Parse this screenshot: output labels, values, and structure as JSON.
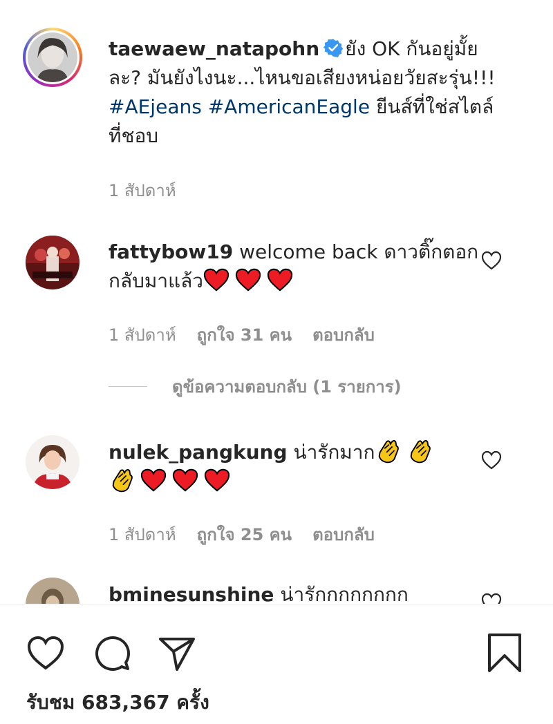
{
  "post": {
    "author": "taewaew_natapohn",
    "caption_plain": "ยัง OK กันอยู่มั้ยละ? มันยังไงนะ...ไหนขอเสียงหน่อยวัยสะรุ่น!!! ",
    "hashtag1": "#AEjeans",
    "hashtag2": "#AmericanEagle",
    "caption_tail": " ยีนส์ที่ใช่สไตล์ที่ชอบ",
    "time": "1 สัปดาห์",
    "verified_icon": "verified-badge"
  },
  "comments": [
    {
      "username": "fattybow19",
      "text": "welcome back ดาวติ๊กตอกกลับมาแล้ว",
      "time": "1 สัปดาห์",
      "likes": "ถูกใจ 31 คน",
      "reply": "ตอบกลับ",
      "view_replies": "ดูข้อความตอบกลับ (1 รายการ)"
    },
    {
      "username": "nulek_pangkung",
      "text": "น่ารักมาก",
      "time": "1 สัปดาห์",
      "likes": "ถูกใจ 25 คน",
      "reply": "ตอบกลับ"
    },
    {
      "username": "bminesunshine",
      "text": "น่ารักกกกกกกก"
    }
  ],
  "footer": {
    "views": "รับชม 683,367 ครั้ง"
  },
  "colors": {
    "text": "#262626",
    "muted": "#8e8e8e",
    "hashtag": "#00376b",
    "verified": "#3897f0",
    "heart": "#ed1c24",
    "clap": "#f5c518"
  }
}
